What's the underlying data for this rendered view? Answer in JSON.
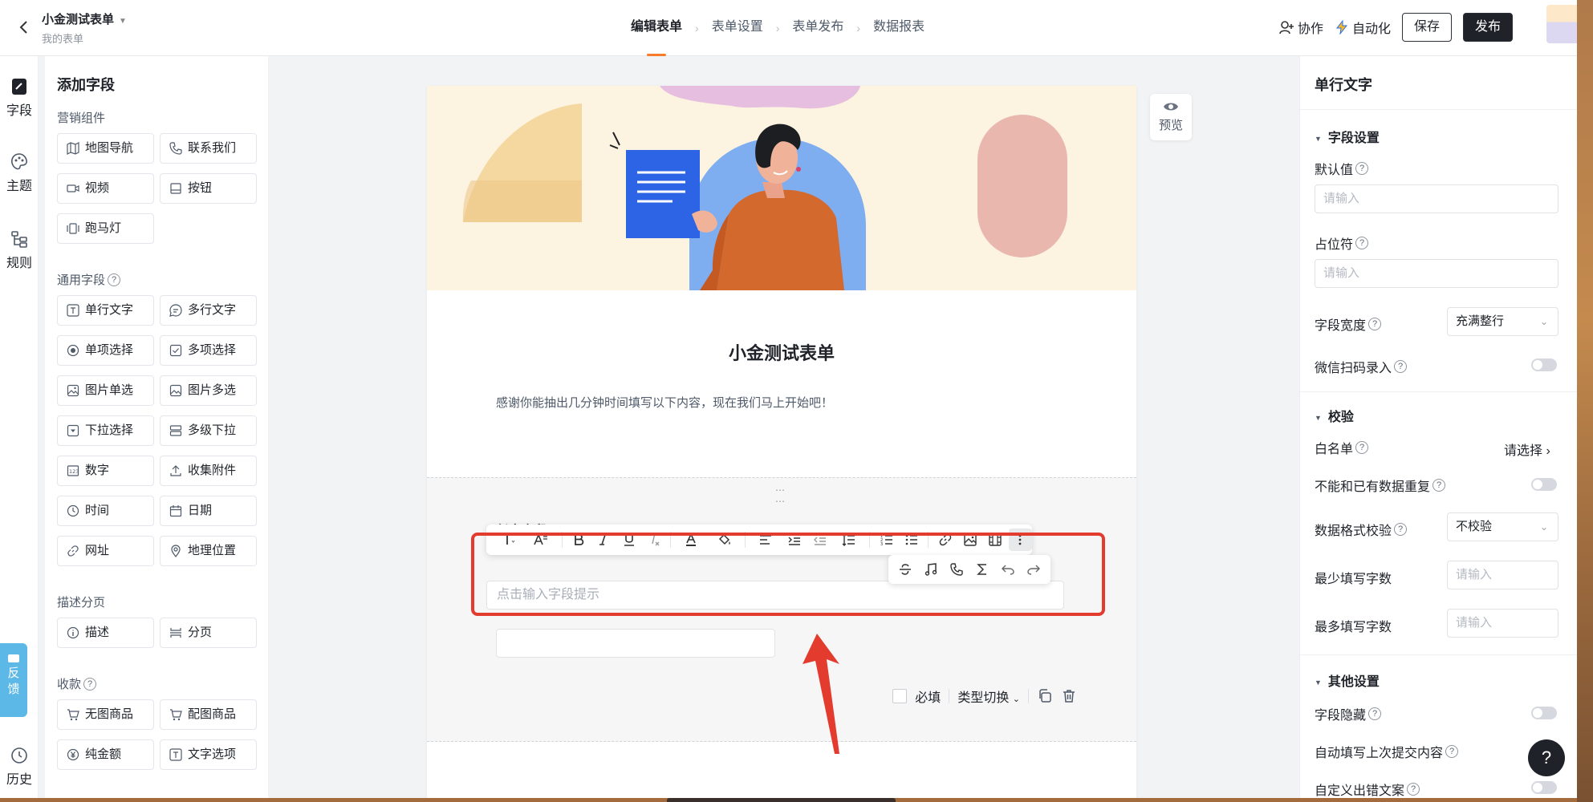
{
  "header": {
    "back_icon": "chevron-left-icon",
    "form_title": "小金测试表单",
    "form_sub": "我的表单",
    "steps": [
      "编辑表单",
      "表单设置",
      "表单发布",
      "数据报表"
    ],
    "collab": "协作",
    "automation": "自动化",
    "save": "保存",
    "publish": "发布"
  },
  "rail": {
    "items": [
      "字段",
      "主题",
      "规则"
    ],
    "feedback": "反馈",
    "history": "历史"
  },
  "fields_panel": {
    "title": "添加字段",
    "groups": [
      {
        "title": "营销组件",
        "items": [
          "地图导航",
          "联系我们",
          "视频",
          "按钮",
          "跑马灯"
        ]
      },
      {
        "title": "通用字段",
        "items": [
          "单行文字",
          "多行文字",
          "单项选择",
          "多项选择",
          "图片单选",
          "图片多选",
          "下拉选择",
          "多级下拉",
          "数字",
          "收集附件",
          "时间",
          "日期",
          "网址",
          "地理位置"
        ]
      },
      {
        "title": "描述分页",
        "items": [
          "描述",
          "分页"
        ]
      },
      {
        "title": "收款",
        "items": [
          "无图商品",
          "配图商品",
          "纯金额",
          "文字选项"
        ]
      }
    ]
  },
  "canvas": {
    "preview": "预览",
    "form_heading": "小金测试表单",
    "form_desc": "感谢你能抽出几分钟时间填写以下内容，现在我们马上开始吧！",
    "field_label": "任意字段",
    "hint_placeholder": "点击输入字段提示",
    "required": "必填",
    "type_switch": "类型切换"
  },
  "props": {
    "title": "单行文字",
    "sec_field": "字段设置",
    "default_label": "默认值",
    "default_ph": "请输入",
    "placeholder_label": "占位符",
    "placeholder_ph": "请输入",
    "width_label": "字段宽度",
    "width_value": "充满整行",
    "wechat_label": "微信扫码录入",
    "sec_validate": "校验",
    "whitelist_label": "白名单",
    "whitelist_value": "请选择",
    "nodup_label": "不能和已有数据重复",
    "format_label": "数据格式校验",
    "format_value": "不校验",
    "min_label": "最少填写字数",
    "min_ph": "请输入",
    "max_label": "最多填写字数",
    "max_ph": "请输入",
    "sec_other": "其他设置",
    "hidden_label": "字段隐藏",
    "autofill_label": "自动填写上次提交内容",
    "custom_err_label": "自定义出错文案",
    "help": "?"
  },
  "colors": {
    "accent": "#f77b2b",
    "highlight": "#e33b2e",
    "feedback": "#5cb8e6"
  }
}
